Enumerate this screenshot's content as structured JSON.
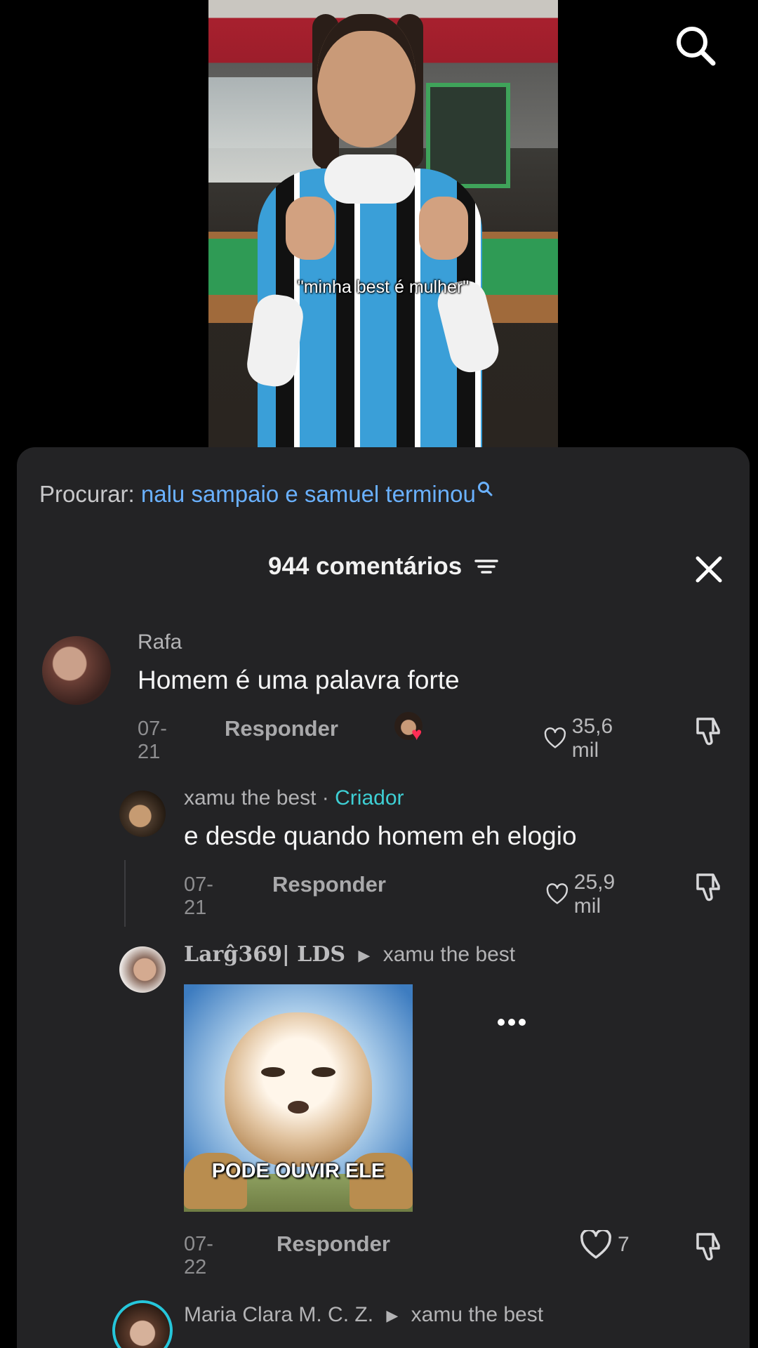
{
  "video": {
    "caption": "\"minha best é mulher\"",
    "search_icon": "search-icon"
  },
  "sheet": {
    "search_prefix": "Procurar:",
    "search_query": "nalu sampaio e samuel terminou",
    "comment_count": "944 comentários",
    "filter_icon": "filter-icon",
    "close_icon": "close-icon"
  },
  "comments": [
    {
      "user": "Rafa",
      "text": "Homem é uma palavra forte",
      "date": "07-21",
      "reply_label": "Responder",
      "likes": "35,6 mil",
      "creator_liked": true
    },
    {
      "user": "xamu the best",
      "separator": "·",
      "badge": "Criador",
      "text": "e desde quando homem eh elogio",
      "date": "07-21",
      "reply_label": "Responder",
      "likes": "25,9 mil"
    },
    {
      "user": "Larĝ369| LDS",
      "reply_to": "xamu the best",
      "sticker_caption": "PODE OUVIR ELE",
      "date": "07-22",
      "reply_label": "Responder",
      "likes": "7"
    },
    {
      "user": "Maria Clara M. C. Z.",
      "reply_to": "xamu the best"
    }
  ],
  "colors": {
    "sheet_bg": "#232325",
    "link_blue": "#6ab1ff",
    "creator_teal": "#3ecfd4",
    "story_ring": "#26c6da"
  }
}
